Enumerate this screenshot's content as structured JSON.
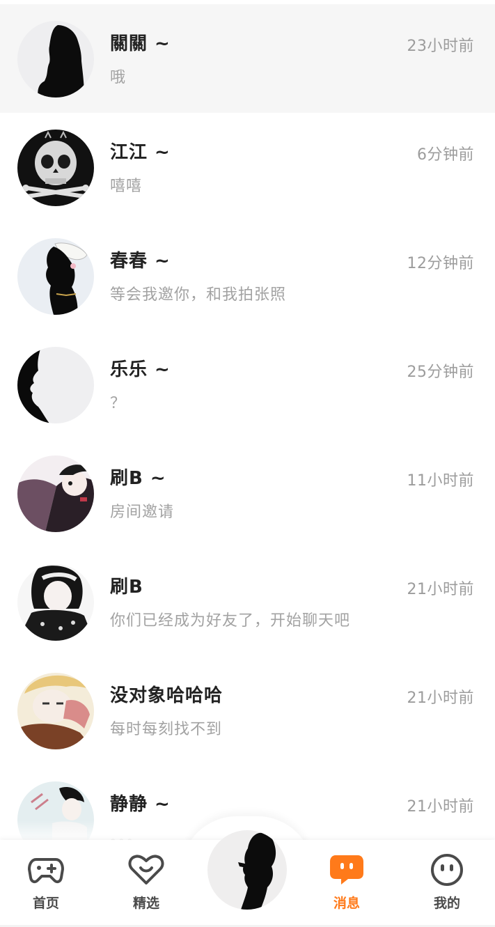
{
  "conversations": [
    {
      "name": "關關 ~",
      "preview": "哦",
      "time": "23小时前",
      "avatar": "silhouette-avatar"
    },
    {
      "name": "江江 ~",
      "preview": "嘻嘻",
      "time": "6分钟前",
      "avatar": "skull-avatar"
    },
    {
      "name": "春春 ~",
      "preview": "等会我邀你，和我拍张照",
      "time": "12分钟前",
      "avatar": "girl-silhouette-avatar"
    },
    {
      "name": "乐乐 ~",
      "preview": "？",
      "time": "25分钟前",
      "avatar": "profile-silhouette-avatar"
    },
    {
      "name": "刷B ~",
      "preview": "房间邀请",
      "time": "11小时前",
      "avatar": "anime-girl-avatar"
    },
    {
      "name": "刷B",
      "preview": "你们已经成为好友了，开始聊天吧",
      "time": "21小时前",
      "avatar": "anime-girl-salute-avatar"
    },
    {
      "name": "没对象哈哈哈",
      "preview": "每时每刻找不到",
      "time": "21小时前",
      "avatar": "anime-blonde-avatar"
    },
    {
      "name": "静静 ~",
      "preview": "。。。",
      "time": "21小时前",
      "avatar": "anime-boy-avatar"
    }
  ],
  "tabbar": {
    "home_label": "首页",
    "featured_label": "精选",
    "messages_label": "消息",
    "mine_label": "我的",
    "active_tab": "messages",
    "accent_color": "#ff7a1a"
  },
  "icons": {
    "home": "gamepad-icon",
    "featured": "heart-icon",
    "messages": "chat-bubble-icon",
    "mine": "face-icon",
    "center": "profile-avatar"
  }
}
